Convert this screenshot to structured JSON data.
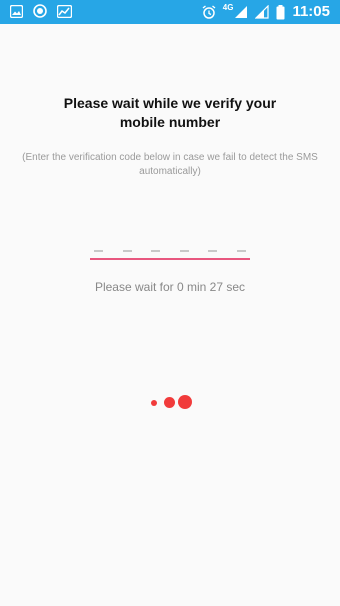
{
  "status_bar": {
    "network_label": "4G",
    "time": "11:05",
    "icons": [
      "image-icon",
      "circle-app-icon",
      "chart-app-icon",
      "alarm-icon",
      "signal-icon",
      "signal-icon-2",
      "battery-icon"
    ]
  },
  "verify": {
    "title_line1": "Please wait while we verify your",
    "title_line2": "mobile number",
    "subtitle_line1": "(Enter the verification code below in case we fail to detect the SMS",
    "subtitle_line2": "automatically)",
    "code_length": 6,
    "code_value": "",
    "timer_prefix": "Please wait for ",
    "timer_value": "0 min 27 sec"
  },
  "colors": {
    "status_bar": "#27a6e6",
    "accent_underline": "#e8577f",
    "loader_dot": "#f13b3b"
  }
}
